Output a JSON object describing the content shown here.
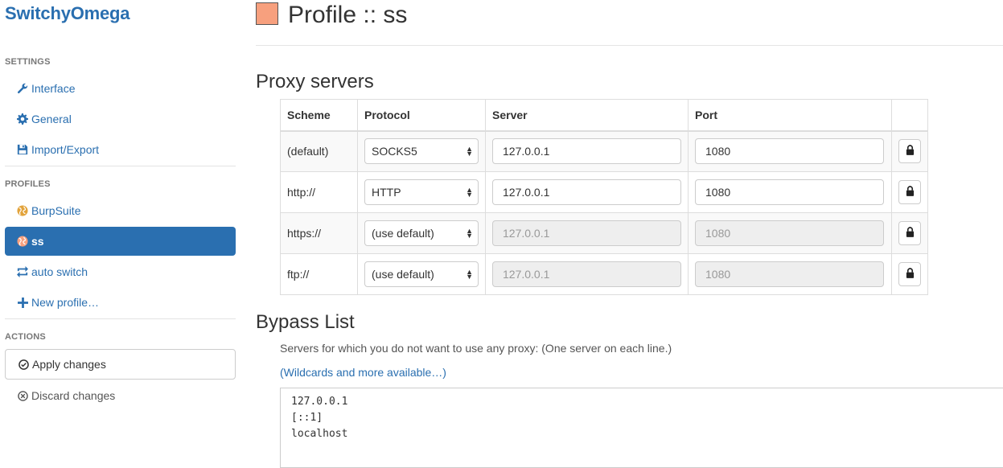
{
  "sidebar": {
    "brand": "SwitchyOmega",
    "settings_header": "SETTINGS",
    "settings_items": [
      {
        "label": "Interface",
        "icon": "wrench-icon"
      },
      {
        "label": "General",
        "icon": "gear-icon"
      },
      {
        "label": "Import/Export",
        "icon": "floppy-icon"
      }
    ],
    "profiles_header": "PROFILES",
    "profile_items": [
      {
        "label": "BurpSuite",
        "icon": "globe-icon"
      },
      {
        "label": "ss",
        "icon": "globe-icon",
        "active": true
      },
      {
        "label": "auto switch",
        "icon": "switch-icon"
      },
      {
        "label": "New profile…",
        "icon": "plus-icon"
      }
    ],
    "actions_header": "ACTIONS",
    "apply_label": "Apply changes",
    "discard_label": "Discard changes"
  },
  "main": {
    "title": "Profile :: ss",
    "profile_color": "#f7a07e",
    "proxy_section_title": "Proxy servers",
    "table_headers": [
      "Scheme",
      "Protocol",
      "Server",
      "Port",
      ""
    ],
    "rows": [
      {
        "scheme": "(default)",
        "protocol": "SOCKS5",
        "server": "127.0.0.1",
        "port": "1080",
        "disabled": false
      },
      {
        "scheme": "http://",
        "protocol": "HTTP",
        "server": "127.0.0.1",
        "port": "1080",
        "disabled": false
      },
      {
        "scheme": "https://",
        "protocol": "(use default)",
        "server": "127.0.0.1",
        "port": "1080",
        "disabled": true
      },
      {
        "scheme": "ftp://",
        "protocol": "(use default)",
        "server": "127.0.0.1",
        "port": "1080",
        "disabled": true
      }
    ],
    "bypass_section_title": "Bypass List",
    "bypass_help": "Servers for which you do not want to use any proxy: (One server on each line.)",
    "bypass_link": "(Wildcards and more available…)",
    "bypass_entries": [
      "127.0.0.1",
      "[::1]",
      "localhost"
    ]
  },
  "colors": {
    "accent": "#2a6fb0",
    "active_bg": "#2a6fb0"
  }
}
